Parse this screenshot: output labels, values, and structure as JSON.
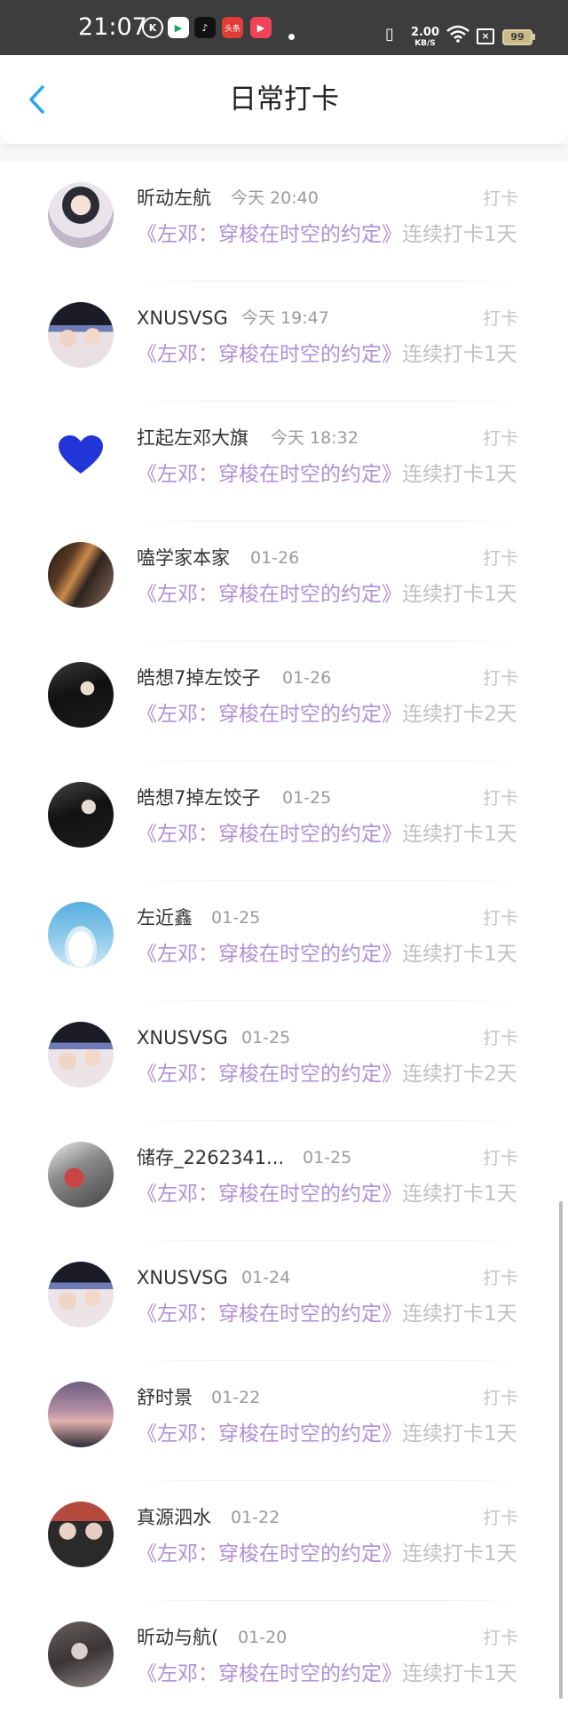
{
  "status_bar": {
    "time": "21:07",
    "app_icons": [
      "k-app-icon",
      "video-app-icon",
      "tiktok-icon",
      "toutiao-icon",
      "media-app-icon"
    ],
    "app_icon_labels": {
      "k": "K",
      "toutiao": "头条"
    },
    "net_speed": "2.00",
    "net_speed_unit": "KB/S",
    "battery": "99"
  },
  "header": {
    "back_icon": "chevron-left-icon",
    "title": "日常打卡",
    "accent_color": "#2aa8e8"
  },
  "colors": {
    "book_title": "#b18fd6",
    "streak_text": "#c1c1c1",
    "checkin_text": "#c6c6c6",
    "time_text": "#9a9a9a"
  },
  "entries": [
    {
      "name": "昕动左航",
      "time": "今天 20:40",
      "action": "打卡",
      "book": "《左邓：穿梭在时空的约定》",
      "streak": "连续打卡1天"
    },
    {
      "name": "XNUSVSG",
      "time": "今天 19:47",
      "action": "打卡",
      "book": "《左邓：穿梭在时空的约定》",
      "streak": "连续打卡1天"
    },
    {
      "name": "扛起左邓大旗",
      "time": "今天 18:32",
      "action": "打卡",
      "book": "《左邓：穿梭在时空的约定》",
      "streak": "连续打卡1天"
    },
    {
      "name": "嗑学家本家",
      "time": "01-26",
      "action": "打卡",
      "book": "《左邓：穿梭在时空的约定》",
      "streak": "连续打卡1天"
    },
    {
      "name": "皓想7掉左饺子",
      "time": "01-26",
      "action": "打卡",
      "book": "《左邓：穿梭在时空的约定》",
      "streak": "连续打卡2天"
    },
    {
      "name": "皓想7掉左饺子",
      "time": "01-25",
      "action": "打卡",
      "book": "《左邓：穿梭在时空的约定》",
      "streak": "连续打卡1天"
    },
    {
      "name": "左近鑫",
      "time": "01-25",
      "action": "打卡",
      "book": "《左邓：穿梭在时空的约定》",
      "streak": "连续打卡1天"
    },
    {
      "name": "XNUSVSG",
      "time": "01-25",
      "action": "打卡",
      "book": "《左邓：穿梭在时空的约定》",
      "streak": "连续打卡2天"
    },
    {
      "name": "储存_2262341...",
      "time": "01-25",
      "action": "打卡",
      "book": "《左邓：穿梭在时空的约定》",
      "streak": "连续打卡1天"
    },
    {
      "name": "XNUSVSG",
      "time": "01-24",
      "action": "打卡",
      "book": "《左邓：穿梭在时空的约定》",
      "streak": "连续打卡1天"
    },
    {
      "name": "舒时景",
      "time": "01-22",
      "action": "打卡",
      "book": "《左邓：穿梭在时空的约定》",
      "streak": "连续打卡1天"
    },
    {
      "name": "真源泗水",
      "time": "01-22",
      "action": "打卡",
      "book": "《左邓：穿梭在时空的约定》",
      "streak": "连续打卡1天"
    },
    {
      "name": "昕动与航(",
      "time": "01-20",
      "action": "打卡",
      "book": "《左邓：穿梭在时空的约定》",
      "streak": "连续打卡1天"
    }
  ]
}
